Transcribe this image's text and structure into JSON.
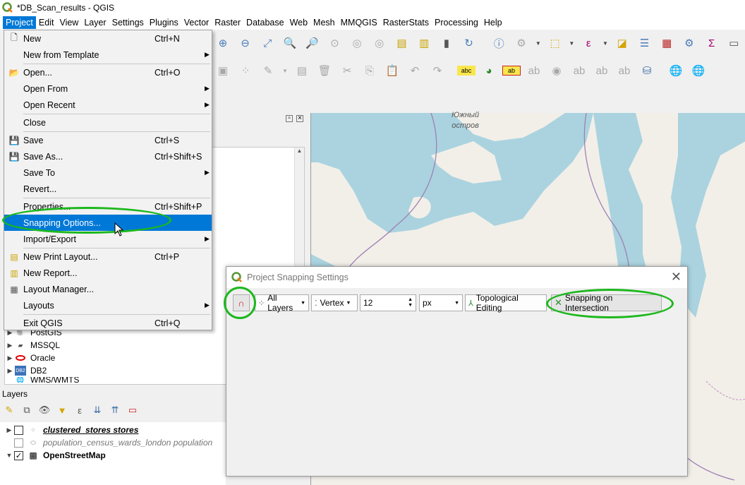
{
  "window": {
    "title": "*DB_Scan_results - QGIS"
  },
  "menubar": [
    "Project",
    "Edit",
    "View",
    "Layer",
    "Settings",
    "Plugins",
    "Vector",
    "Raster",
    "Database",
    "Web",
    "Mesh",
    "MMQGIS",
    "RasterStats",
    "Processing",
    "Help"
  ],
  "project_menu": {
    "items": [
      {
        "label": "New",
        "shortcut": "Ctrl+N",
        "icon": "new-file-icon"
      },
      {
        "label": "New from Template",
        "submenu": true
      },
      {
        "label": "Open...",
        "shortcut": "Ctrl+O",
        "icon": "folder-open-icon"
      },
      {
        "label": "Open From",
        "submenu": true
      },
      {
        "label": "Open Recent",
        "submenu": true
      },
      {
        "label": "Close"
      },
      {
        "label": "Save",
        "shortcut": "Ctrl+S",
        "icon": "save-icon"
      },
      {
        "label": "Save As...",
        "shortcut": "Ctrl+Shift+S",
        "icon": "save-as-icon"
      },
      {
        "label": "Save To",
        "submenu": true
      },
      {
        "label": "Revert..."
      },
      {
        "label": "Properties...",
        "shortcut": "Ctrl+Shift+P"
      },
      {
        "label": "Snapping Options...",
        "highlighted": true
      },
      {
        "label": "Import/Export",
        "submenu": true
      },
      {
        "label": "New Print Layout...",
        "shortcut": "Ctrl+P",
        "icon": "print-layout-icon"
      },
      {
        "label": "New Report...",
        "icon": "report-icon"
      },
      {
        "label": "Layout Manager...",
        "icon": "layout-manager-icon"
      },
      {
        "label": "Layouts",
        "submenu": true
      },
      {
        "label": "Exit QGIS",
        "shortcut": "Ctrl+Q"
      }
    ]
  },
  "browser": {
    "items": [
      {
        "label": "PostGIS"
      },
      {
        "label": "MSSQL"
      },
      {
        "label": "Oracle"
      },
      {
        "label": "DB2",
        "icon_text": "DB2"
      },
      {
        "label": "WMS/WMTS"
      }
    ]
  },
  "layers_panel": {
    "title": "Layers",
    "layers": [
      {
        "name": "clustered_stores stores",
        "checked": false,
        "style": "bold-italic-underline"
      },
      {
        "name": "population_census_wards_london population",
        "checked": false,
        "style": "italic-grey"
      },
      {
        "name": "OpenStreetMap",
        "checked": true,
        "style": "bold"
      }
    ]
  },
  "map": {
    "labels": [
      "Южный",
      "остров"
    ],
    "water_color": "#aad3df",
    "land_color": "#f2efe9"
  },
  "snapping_dialog": {
    "title": "Project Snapping Settings",
    "layers_button": "All Layers",
    "type_button": "Vertex",
    "tolerance_value": "12",
    "units_value": "px",
    "topological_button": "Topological Editing",
    "intersection_button": "Snapping on Intersection"
  },
  "colors": {
    "highlight_green": "#1db81d",
    "menu_highlight": "#0078d7"
  }
}
